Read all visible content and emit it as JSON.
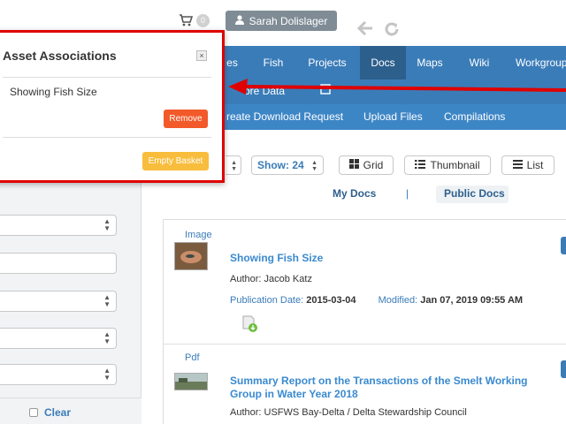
{
  "header": {
    "basket_count": "0",
    "user_name": "Sarah Dolislager"
  },
  "main_nav": {
    "items": [
      {
        "label": "es"
      },
      {
        "label": "Fish"
      },
      {
        "label": "Projects"
      },
      {
        "label": "Docs"
      },
      {
        "label": "Maps"
      },
      {
        "label": "Wiki"
      },
      {
        "label": "Workgroup"
      }
    ],
    "active": "Docs"
  },
  "sub_nav_1": {
    "items": [
      {
        "label": "ore Data"
      }
    ]
  },
  "sub_nav_2": {
    "items": [
      {
        "label": "reate Download Request"
      },
      {
        "label": "Upload Files"
      },
      {
        "label": "Compilations"
      }
    ]
  },
  "left_filters": {
    "clear_label": "Clear"
  },
  "toolbar": {
    "show_label": "Show: 24",
    "grid_label": "Grid",
    "thumbnail_label": "Thumbnail",
    "list_label": "List"
  },
  "doc_tabs": {
    "my_docs": "My Docs",
    "separator": "|",
    "public_docs": "Public Docs"
  },
  "results": [
    {
      "type": "Image",
      "title": "Showing Fish Size",
      "author": "Author: Jacob Katz",
      "pub_label": "Publication Date:",
      "pub_date": "2015-03-04",
      "mod_label": "Modified:",
      "mod_date": "Jan 07, 2019 09:55 AM"
    },
    {
      "type": "Pdf",
      "title": "Summary Report on the Transactions of the Smelt Working Group in Water Year 2018",
      "author": "Author: USFWS Bay-Delta / Delta Stewardship Council"
    }
  ],
  "popup": {
    "title": "Asset Associations",
    "close_label": "×",
    "item": "Showing Fish Size",
    "remove_label": "Remove",
    "empty_label": "Empty Basket"
  },
  "colors": {
    "nav_blue": "#3a7cb8",
    "nav_active": "#2d5f8d",
    "remove_orange": "#f25a2a",
    "empty_yellow": "#f8bd3c",
    "annotation_red": "#e00000"
  }
}
